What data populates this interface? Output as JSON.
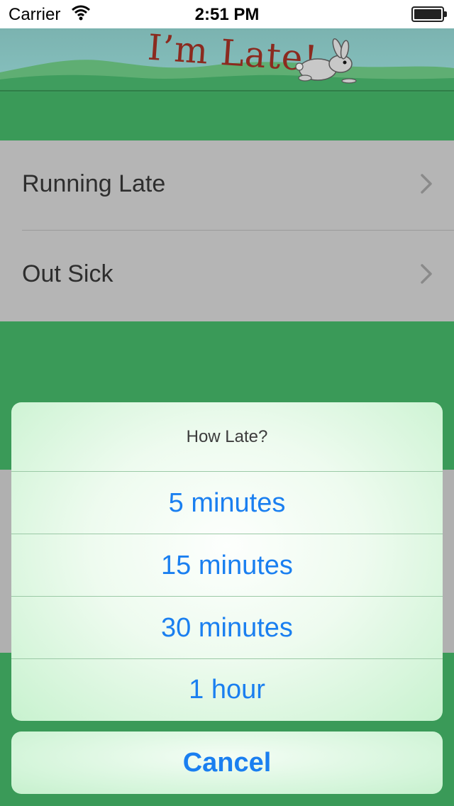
{
  "status_bar": {
    "carrier": "Carrier",
    "time": "2:51 PM",
    "wifi_icon": "wifi-icon",
    "battery_level": 1.0
  },
  "header": {
    "logo_text": "I’m Late!",
    "logo_icon": "rabbit-icon"
  },
  "menu": {
    "items": [
      {
        "label": "Running Late",
        "icon": "chevron-right-icon"
      },
      {
        "label": "Out Sick",
        "icon": "chevron-right-icon"
      }
    ]
  },
  "action_sheet": {
    "title": "How Late?",
    "options": [
      "5 minutes",
      "15 minutes",
      "30 minutes",
      "1 hour"
    ],
    "cancel_label": "Cancel"
  },
  "colors": {
    "background_green": "#3a9a58",
    "sheet_green": "#c8f2cf",
    "action_blue": "#1a7ff0",
    "logo_red": "#8b2a1f"
  }
}
